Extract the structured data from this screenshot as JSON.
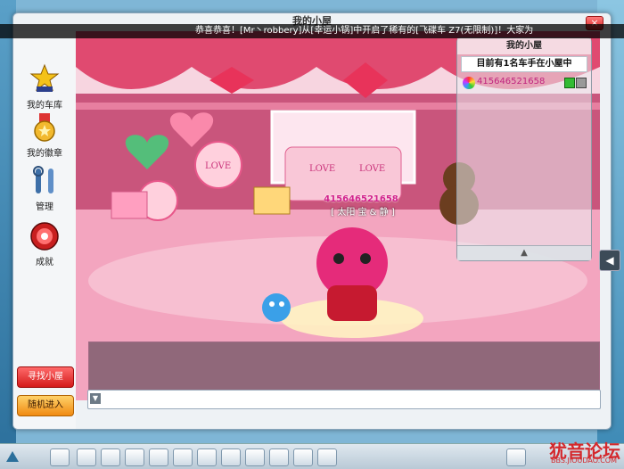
{
  "window": {
    "title": "我的小屋",
    "close_label": "×"
  },
  "announcement": "恭喜恭喜！[Mr丶robbery]从[幸运小锅]中开启了稀有的[飞碟车 Z7(无限制)]！大家为",
  "sidebar": {
    "items": [
      {
        "label": "我的车库",
        "icon": "garage-star-icon"
      },
      {
        "label": "我的徽章",
        "icon": "medal-icon"
      },
      {
        "label": "管理",
        "icon": "tools-icon"
      },
      {
        "label": "成就",
        "icon": "achievement-icon"
      }
    ],
    "find_room_label": "寻找小屋",
    "random_enter_label": "随机进入"
  },
  "room_panel": {
    "title": "我的小屋",
    "occupancy": "目前有1名车手在小屋中",
    "users": [
      {
        "name": "415646521658"
      }
    ],
    "scroll_up": "▲"
  },
  "player": {
    "name": "415646521658",
    "title": "[ 太阳 宝 & 静 ]"
  },
  "chat": {
    "placeholder": "",
    "toggle": "▼"
  },
  "collapse_label": "◀",
  "watermark": {
    "text": "犹音论坛",
    "url": "BBS.JIOUDAO.COM"
  },
  "colors": {
    "accent_red": "#d41a1a",
    "accent_orange": "#f08a12",
    "name_pink": "#d2238c"
  }
}
